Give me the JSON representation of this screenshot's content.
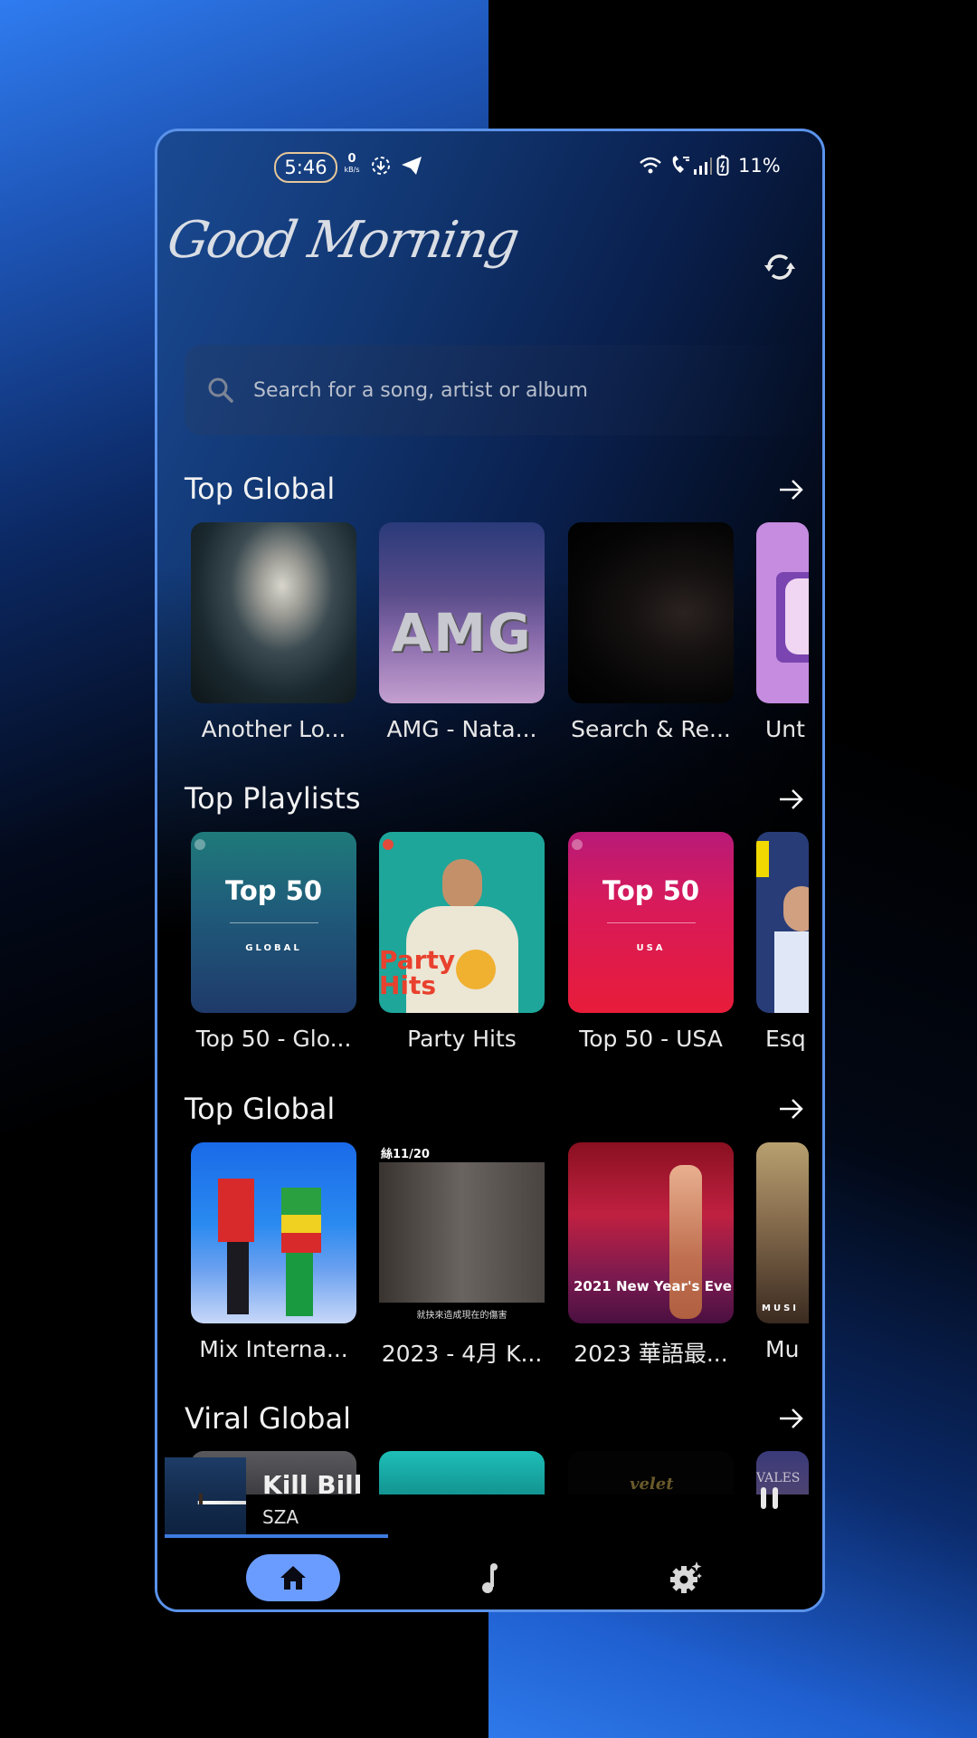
{
  "status_bar": {
    "time": "5:46",
    "net_speed_value": "0",
    "net_speed_unit": "kB/s",
    "icons_left": [
      "download-icon",
      "telegram-icon"
    ],
    "icons_right": [
      "wifi-icon",
      "wifi-calling-icon",
      "signal-icon",
      "battery-icon"
    ],
    "battery": "11%"
  },
  "header": {
    "greeting": "Good Morning",
    "refresh_icon": "refresh-icon"
  },
  "search": {
    "placeholder": "Search for a song, artist or album",
    "value": ""
  },
  "sections": [
    {
      "title": "Top Global",
      "items": [
        {
          "caption": "Another Lo...",
          "art": "portrait-blond-man"
        },
        {
          "caption": "AMG - Nata...",
          "art": "amg-cover"
        },
        {
          "caption": "Search & Re...",
          "art": "dark-masked-face"
        },
        {
          "caption": "Unt",
          "art": "purple-tv"
        }
      ]
    },
    {
      "title": "Top Playlists",
      "items": [
        {
          "caption": "Top 50 - Glo...",
          "cover_title": "Top 50",
          "cover_sub": "GLOBAL"
        },
        {
          "caption": "Party Hits",
          "cover_title": "Party Hits"
        },
        {
          "caption": "Top 50 - USA",
          "cover_title": "Top 50",
          "cover_sub": "USA"
        },
        {
          "caption": "Esq"
        }
      ]
    },
    {
      "title": "Top Global",
      "items": [
        {
          "caption": "Mix Interna...",
          "art": "dancers-blue"
        },
        {
          "caption": "2023 - 4月 K...",
          "overlay_top": "絲11/20",
          "overlay_bottom": "就抉來造成現在的傷害"
        },
        {
          "caption": "2023 華語最...",
          "overlay_bottom": "2021 New Year's Eve"
        },
        {
          "caption": "Mu",
          "overlay_bottom": "MUSI"
        }
      ]
    },
    {
      "title": "Viral Global",
      "items": [
        {
          "caption": ""
        },
        {
          "caption": ""
        },
        {
          "caption": "",
          "overlay_text": "velet"
        },
        {
          "caption": "",
          "overlay_text": "VALES"
        }
      ]
    }
  ],
  "mini_player": {
    "title": "Kill Bill",
    "artist": "SZA",
    "progress_fraction": 0.35,
    "state": "playing"
  },
  "nav": {
    "items": [
      {
        "name": "home",
        "icon": "home-icon",
        "active": true
      },
      {
        "name": "music",
        "icon": "music-note-icon",
        "active": false
      },
      {
        "name": "settings",
        "icon": "settings-sparkle-icon",
        "active": false
      }
    ],
    "accent": "#6a9cff"
  },
  "colors": {
    "frame_border": "#5a92ea",
    "progress": "#3d7be0",
    "time_pill_border": "#e6c79a"
  }
}
